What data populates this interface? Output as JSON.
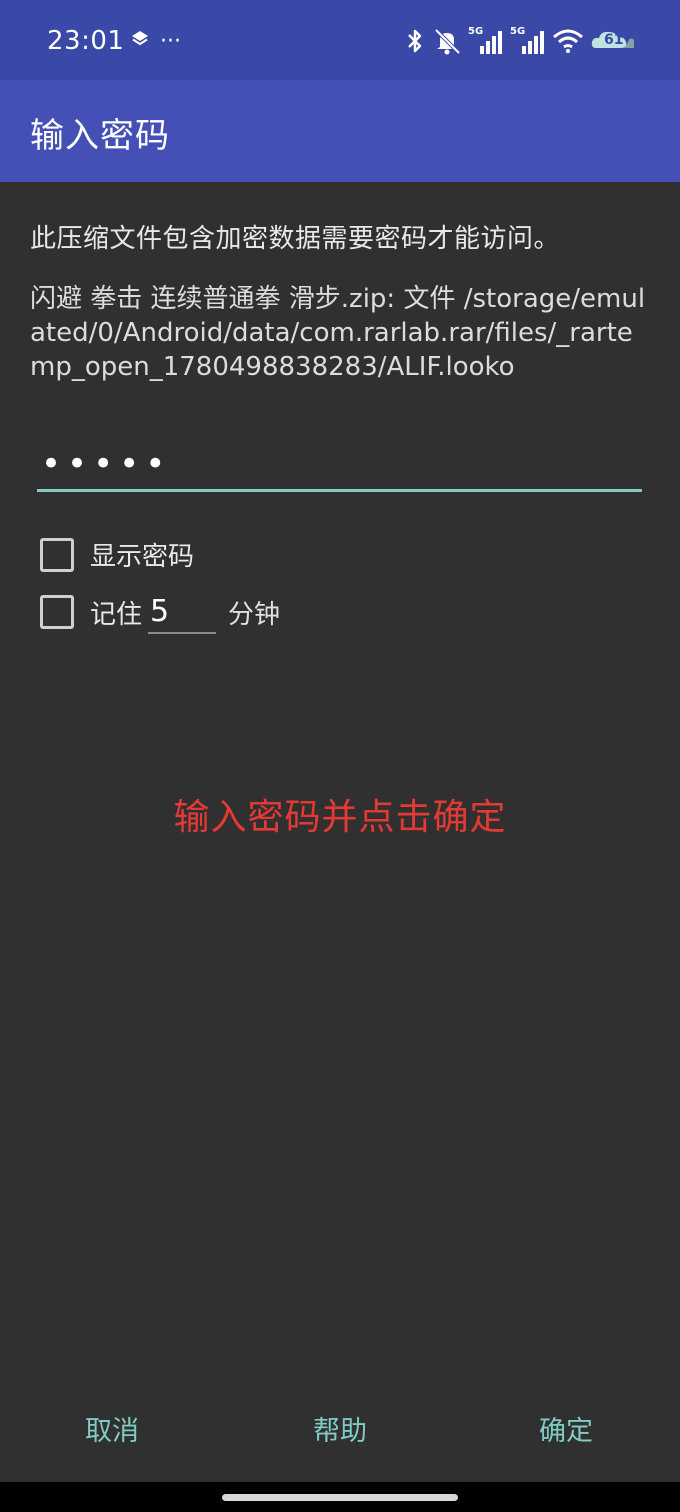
{
  "status_bar": {
    "time": "23:01",
    "more": "···",
    "battery": "61",
    "net1": "5G",
    "net2": "5G"
  },
  "app_bar": {
    "title": "输入密码"
  },
  "dialog": {
    "message": "此压缩文件包含加密数据需要密码才能访问。",
    "file_info": "闪避 拳击 连续普通拳 滑步.zip: 文件 /storage/emulated/0/Android/data/com.rarlab.rar/files/_rartemp_open_1780498838283/ALIF.looko",
    "password_value": "•••••",
    "show_password_label": "显示密码",
    "remember_label": "记住",
    "remember_minutes": "5",
    "minutes_unit": "分钟"
  },
  "overlay_hint": "输入密码并点击确定",
  "buttons": {
    "cancel": "取消",
    "help": "帮助",
    "ok": "确定"
  },
  "colors": {
    "status_bar_bg": "#3a48a7",
    "app_bar_bg": "#4450b5",
    "background": "#303030",
    "accent": "#80cbc4",
    "hint_red": "#e53935"
  }
}
